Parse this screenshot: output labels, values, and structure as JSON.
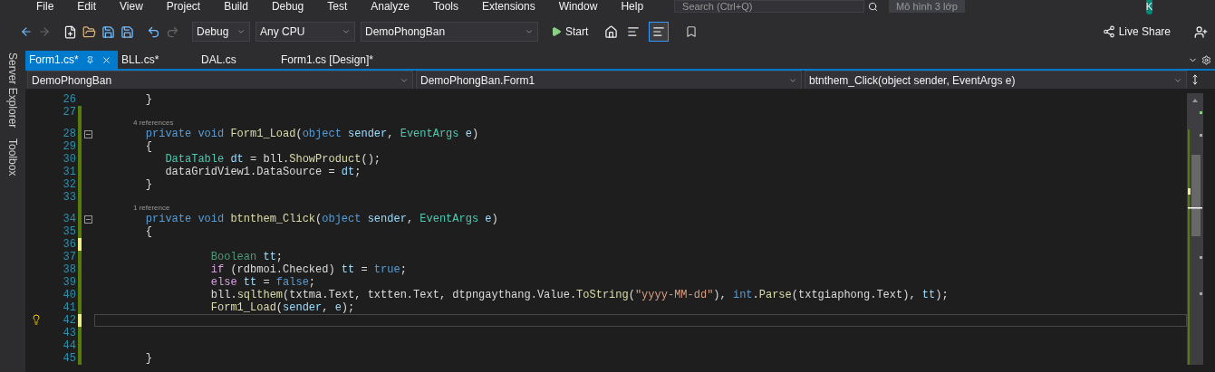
{
  "menu": [
    "File",
    "Edit",
    "View",
    "Project",
    "Build",
    "Debug",
    "Test",
    "Analyze",
    "Tools",
    "Extensions",
    "Window",
    "Help"
  ],
  "search": {
    "placeholder": "Search (Ctrl+Q)"
  },
  "window_title": "Mô hình 3 lớp",
  "account": {
    "initial": "K"
  },
  "toolbar": {
    "configuration": "Debug",
    "platform": "Any CPU",
    "project": "DemoPhongBan",
    "start": "Start",
    "live_share": "Live Share",
    "toggles": [
      {
        "selected": false
      },
      {
        "selected": true
      }
    ]
  },
  "side_rail": [
    "Server Explorer",
    "Toolbox"
  ],
  "tabs": [
    {
      "label": "Form1.cs*",
      "selected": true
    },
    {
      "label": "BLL.cs*",
      "selected": false
    },
    {
      "label": "DAL.cs",
      "selected": false
    },
    {
      "label": "Form1.cs [Design]*",
      "selected": false
    }
  ],
  "nav_bar": {
    "project": "DemoPhongBan",
    "type": "DemoPhongBan.Form1",
    "member": "btnthem_Click(object sender, EventArgs e)"
  },
  "editor": {
    "lines": [
      {
        "kind": "code",
        "number": "26",
        "modified": false,
        "fold": false,
        "bulb": false,
        "current": false,
        "tokens": [
          {
            "kind": "plain",
            "text": "    }"
          }
        ]
      },
      {
        "kind": "code",
        "number": "27",
        "modified": true,
        "saved": true,
        "fold": false,
        "bulb": false,
        "current": false
      },
      {
        "kind": "codelens",
        "text": "4 references"
      },
      {
        "kind": "code",
        "number": "28",
        "modified": true,
        "saved": true,
        "fold": true,
        "bulb": false,
        "current": false,
        "tokens": [
          {
            "kind": "keyword",
            "text": "    private void "
          },
          {
            "kind": "method",
            "text": "Form1_Load"
          },
          {
            "kind": "plain",
            "text": "("
          },
          {
            "kind": "keyword",
            "text": "object "
          },
          {
            "kind": "local",
            "text": "sender"
          },
          {
            "kind": "plain",
            "text": ", "
          },
          {
            "kind": "type",
            "text": "EventArgs "
          },
          {
            "kind": "local",
            "text": "e"
          },
          {
            "kind": "plain",
            "text": ")"
          }
        ]
      },
      {
        "kind": "code",
        "number": "29",
        "modified": true,
        "saved": true,
        "fold": false,
        "bulb": false,
        "current": false,
        "tokens": [
          {
            "kind": "plain",
            "text": "    {"
          }
        ]
      },
      {
        "kind": "code",
        "number": "30",
        "modified": true,
        "saved": true,
        "fold": false,
        "bulb": false,
        "current": false,
        "tokens": [
          {
            "kind": "type",
            "text": "       DataTable "
          },
          {
            "kind": "local",
            "text": "dt"
          },
          {
            "kind": "plain",
            "text": " = bll."
          },
          {
            "kind": "method",
            "text": "ShowProduct"
          },
          {
            "kind": "plain",
            "text": "();"
          }
        ]
      },
      {
        "kind": "code",
        "number": "31",
        "modified": true,
        "saved": true,
        "fold": false,
        "bulb": false,
        "current": false,
        "tokens": [
          {
            "kind": "plain",
            "text": "       dataGridView1.DataSource = "
          },
          {
            "kind": "local",
            "text": "dt"
          },
          {
            "kind": "plain",
            "text": ";"
          }
        ]
      },
      {
        "kind": "code",
        "number": "32",
        "modified": true,
        "saved": true,
        "fold": false,
        "bulb": false,
        "current": false,
        "tokens": [
          {
            "kind": "plain",
            "text": "    }"
          }
        ]
      },
      {
        "kind": "code",
        "number": "33",
        "modified": true,
        "saved": true,
        "fold": false,
        "bulb": false,
        "current": false
      },
      {
        "kind": "codelens",
        "text": "1 reference"
      },
      {
        "kind": "code",
        "number": "34",
        "modified": true,
        "saved": true,
        "fold": true,
        "bulb": false,
        "current": false,
        "tokens": [
          {
            "kind": "keyword",
            "text": "    private void "
          },
          {
            "kind": "method",
            "text": "btnthem_Click"
          },
          {
            "kind": "plain",
            "text": "("
          },
          {
            "kind": "keyword",
            "text": "object "
          },
          {
            "kind": "local",
            "text": "sender"
          },
          {
            "kind": "plain",
            "text": ", "
          },
          {
            "kind": "type",
            "text": "EventArgs "
          },
          {
            "kind": "local",
            "text": "e"
          },
          {
            "kind": "plain",
            "text": ")"
          }
        ]
      },
      {
        "kind": "code",
        "number": "35",
        "modified": true,
        "saved": true,
        "fold": false,
        "bulb": false,
        "current": false,
        "tokens": [
          {
            "kind": "plain",
            "text": "    {"
          }
        ]
      },
      {
        "kind": "code",
        "number": "36",
        "modified": true,
        "saved": false,
        "fold": false,
        "bulb": false,
        "current": false
      },
      {
        "kind": "code",
        "number": "37",
        "modified": true,
        "saved": true,
        "fold": false,
        "bulb": false,
        "current": false,
        "tokens": [
          {
            "kind": "dim_type",
            "text": "              Boolean "
          },
          {
            "kind": "local",
            "text": "tt"
          },
          {
            "kind": "plain",
            "text": ";"
          }
        ]
      },
      {
        "kind": "code",
        "number": "38",
        "modified": true,
        "saved": true,
        "fold": false,
        "bulb": false,
        "current": false,
        "tokens": [
          {
            "kind": "control",
            "text": "              if"
          },
          {
            "kind": "plain",
            "text": " (rdbmoi.Checked) "
          },
          {
            "kind": "local",
            "text": "tt"
          },
          {
            "kind": "plain",
            "text": " = "
          },
          {
            "kind": "keyword",
            "text": "true"
          },
          {
            "kind": "plain",
            "text": ";"
          }
        ]
      },
      {
        "kind": "code",
        "number": "39",
        "modified": true,
        "saved": true,
        "fold": false,
        "bulb": false,
        "current": false,
        "tokens": [
          {
            "kind": "control",
            "text": "              else "
          },
          {
            "kind": "local",
            "text": "tt"
          },
          {
            "kind": "plain",
            "text": " = "
          },
          {
            "kind": "keyword",
            "text": "false"
          },
          {
            "kind": "plain",
            "text": ";"
          }
        ]
      },
      {
        "kind": "code",
        "number": "40",
        "modified": true,
        "saved": true,
        "fold": false,
        "bulb": false,
        "current": false,
        "tokens": [
          {
            "kind": "plain",
            "text": "              bll."
          },
          {
            "kind": "method",
            "text": "sqlthem"
          },
          {
            "kind": "plain",
            "text": "(txtma.Text, txtten.Text, dtpngaythang.Value."
          },
          {
            "kind": "method",
            "text": "ToString"
          },
          {
            "kind": "plain",
            "text": "("
          },
          {
            "kind": "string",
            "text": "\"yyyy-MM-dd\""
          },
          {
            "kind": "plain",
            "text": "), "
          },
          {
            "kind": "keyword",
            "text": "int"
          },
          {
            "kind": "plain",
            "text": "."
          },
          {
            "kind": "method",
            "text": "Parse"
          },
          {
            "kind": "plain",
            "text": "(txtgiaphong.Text), "
          },
          {
            "kind": "local",
            "text": "tt"
          },
          {
            "kind": "plain",
            "text": ");"
          }
        ]
      },
      {
        "kind": "code",
        "number": "41",
        "modified": true,
        "saved": true,
        "fold": false,
        "bulb": false,
        "current": false,
        "tokens": [
          {
            "kind": "method",
            "text": "              Form1_Load"
          },
          {
            "kind": "plain",
            "text": "("
          },
          {
            "kind": "local",
            "text": "sender"
          },
          {
            "kind": "plain",
            "text": ", "
          },
          {
            "kind": "local",
            "text": "e"
          },
          {
            "kind": "plain",
            "text": ");"
          }
        ]
      },
      {
        "kind": "code",
        "number": "42",
        "modified": true,
        "saved": false,
        "fold": false,
        "bulb": true,
        "current": true
      },
      {
        "kind": "code",
        "number": "43",
        "modified": true,
        "saved": true,
        "fold": false,
        "bulb": false,
        "current": false
      },
      {
        "kind": "code",
        "number": "44",
        "modified": true,
        "saved": true,
        "fold": false,
        "bulb": false,
        "current": false
      },
      {
        "kind": "code",
        "number": "45",
        "modified": true,
        "saved": true,
        "fold": false,
        "bulb": false,
        "current": false,
        "tokens": [
          {
            "kind": "plain",
            "text": "    }"
          }
        ]
      }
    ]
  }
}
